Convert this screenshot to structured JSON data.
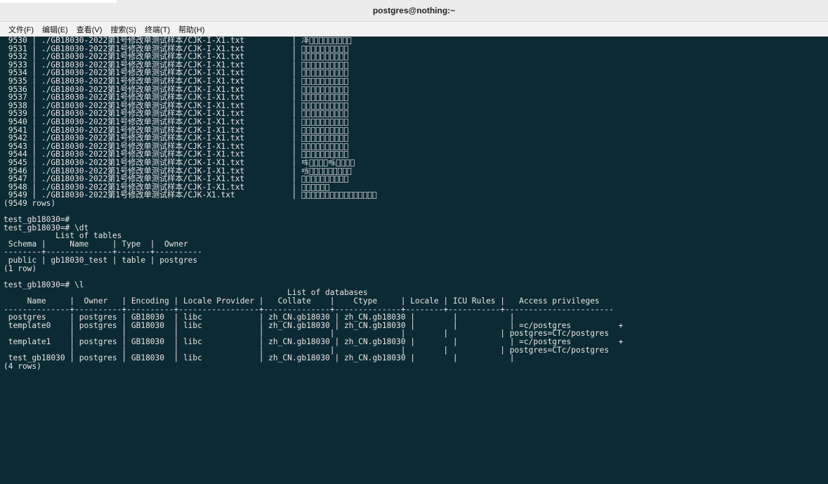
{
  "window": {
    "title": "postgres@nothing:~"
  },
  "menu": [
    {
      "label": "文件(F)"
    },
    {
      "label": "编辑(E)"
    },
    {
      "label": "查看(V)"
    },
    {
      "label": "搜索(S)"
    },
    {
      "label": "终端(T)"
    },
    {
      "label": "帮助(H)"
    }
  ],
  "terminal": {
    "background": "#0c2a33",
    "foreground": "#e6e6e6",
    "lines": [
      " 9530 | ./GB18030-2022第1号修改单测试样本/CJK-I-X1.txt          | 𪞝𪞞𪞟𪞠𪞡𪞢𪞣𪞤𪞥𪞦",
      " 9531 | ./GB18030-2022第1号修改单测试样本/CJK-I-X1.txt          | 𪞧𪞨𪞩𪞪𪞫𪞬𪞭𪞮𪞯𪞰",
      " 9532 | ./GB18030-2022第1号修改单测试样本/CJK-I-X1.txt          | 𪞱𪞲𪞳𪞴𪞵𪞶𪞷𪞸𪞹𪞺",
      " 9533 | ./GB18030-2022第1号修改单测试样本/CJK-I-X1.txt          | 𪞻𪞼𪞽𪞾𪞿𪟀𪟁𪟂𪟃𪟄",
      " 9534 | ./GB18030-2022第1号修改单测试样本/CJK-I-X1.txt          | 𪟅𪟆𪟇𪟈𪟉𪟊𪟋𪟌𪟍𪟎",
      " 9535 | ./GB18030-2022第1号修改单测试样本/CJK-I-X1.txt          | 𪟏𪟐𪟑𪟒𪟓𪟔𪟕𪟖𪟗𪟘",
      " 9536 | ./GB18030-2022第1号修改单测试样本/CJK-I-X1.txt          | 𪟙𪟚𪟛𪟜𪟝𪟞𪟟𪟠𪟡𪟢",
      " 9537 | ./GB18030-2022第1号修改单测试样本/CJK-I-X1.txt          | 𪟣𪟤𪟥𪟦𪟧𪟨𪟩𪟪𪟫𪟬",
      " 9538 | ./GB18030-2022第1号修改单测试样本/CJK-I-X1.txt          | 𪟭𪟮𪟯𪟰𪟱𪟲𪟳𪟴𪟵𪟶",
      " 9539 | ./GB18030-2022第1号修改单测试样本/CJK-I-X1.txt          | 𪟷𪟸𪟹𪟺𪟻𪟼𪟽𪟾𪟿𪠀",
      " 9540 | ./GB18030-2022第1号修改单测试样本/CJK-I-X1.txt          | 𪠁𪠂𪠃𪠄𪠅𪠆𪠇𪠈𪠉𪠊",
      " 9541 | ./GB18030-2022第1号修改单测试样本/CJK-I-X1.txt          | 𪠋𪠌𪠍𪠎𪠏𪠐𪠑𪠒𪠓𪠔",
      " 9542 | ./GB18030-2022第1号修改单测试样本/CJK-I-X1.txt          | 𪠕𪠖𪠗𪠘𪠙𪠚𪠛𪠜𪠝𪠞",
      " 9543 | ./GB18030-2022第1号修改单测试样本/CJK-I-X1.txt          | 𪠟𪠠𪠡𪠢𪠣𪠤𪠥𪠦𪠧𪠨",
      " 9544 | ./GB18030-2022第1号修改单测试样本/CJK-I-X1.txt          | 𪠩𪠪𪠫𪠬𪠭𪠮𪠯𪠰𪠱𪠲",
      " 9545 | ./GB18030-2022第1号修改单测试样本/CJK-I-X1.txt          | 𪠳𪠴𪠵𪠶𪠷𪠸𪠹𪠺𪠻𪠼",
      " 9546 | ./GB18030-2022第1号修改单测试样本/CJK-I-X1.txt          | 𪠽𪠾𪠿𪡀𪡁𪡂𪡃𪡄𪡅𪡆",
      " 9547 | ./GB18030-2022第1号修改单测试样本/CJK-I-X1.txt          | 𪡇𪡈𪡉𪡊𪡋𪡌𪡍𪡎𪡏𪡐",
      " 9548 | ./GB18030-2022第1号修改单测试样本/CJK-I-X1.txt          | 𪡑𪡒𪡓𪡔𪡕𪡖",
      " 9549 | ./GB18030-2022第1号修改单测试样本/CJK-X1.txt            | 𪡗𪡘𪡙𪡚𪡛𪡜𪡝𪡞𪡟𪡠𪡡𪡢𪡣𪡤𪡥𪡦",
      "(9549 rows)",
      "",
      "test_gb18030=#",
      "test_gb18030=# \\dt",
      "           List of tables",
      " Schema |     Name     | Type  |  Owner",
      "--------+--------------+-------+----------",
      " public | gb18030_test | table | postgres",
      "(1 row)",
      "",
      "test_gb18030=# \\l",
      "                                                            List of databases",
      "     Name     |  Owner   | Encoding | Locale Provider |   Collate    |    Ctype     | Locale | ICU Rules |   Access privileges",
      "--------------+----------+----------+-----------------+--------------+--------------+--------+-----------+-----------------------",
      " postgres     | postgres | GB18030  | libc            | zh_CN.gb18030 | zh_CN.gb18030 |        |           |",
      " template0    | postgres | GB18030  | libc            | zh_CN.gb18030 | zh_CN.gb18030 |        |           | =c/postgres          +",
      "              |          |          |                 |              |              |        |           | postgres=CTc/postgres",
      " template1    | postgres | GB18030  | libc            | zh_CN.gb18030 | zh_CN.gb18030 |        |           | =c/postgres          +",
      "              |          |          |                 |              |              |        |           | postgres=CTc/postgres",
      " test_gb18030 | postgres | GB18030  | libc            | zh_CN.gb18030 | zh_CN.gb18030 |        |           |",
      "(4 rows)"
    ]
  }
}
